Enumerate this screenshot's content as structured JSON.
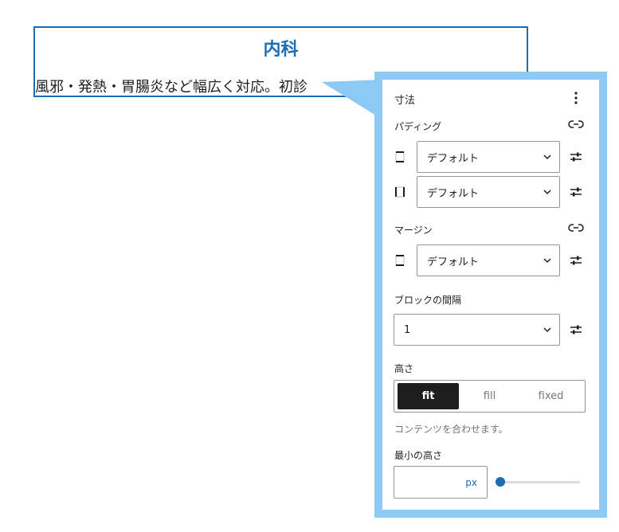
{
  "block": {
    "title": "内科",
    "text": "風邪・発熱・胃腸炎など幅広く対応。初診"
  },
  "panel": {
    "title": "寸法",
    "more_icon": "more-vertical-icon",
    "padding": {
      "label": "パディング",
      "link_icon": "unlink-icon",
      "rows": [
        {
          "side_icon": "padding-vertical-icon",
          "value": "デフォルト",
          "settings_icon": "sliders-icon"
        },
        {
          "side_icon": "padding-horizontal-icon",
          "value": "デフォルト",
          "settings_icon": "sliders-icon"
        }
      ]
    },
    "margin": {
      "label": "マージン",
      "link_icon": "unlink-icon",
      "rows": [
        {
          "side_icon": "margin-vertical-icon",
          "value": "デフォルト",
          "settings_icon": "sliders-icon"
        }
      ]
    },
    "block_spacing": {
      "label": "ブロックの間隔",
      "value": "1",
      "settings_icon": "sliders-icon"
    },
    "height": {
      "label": "高さ",
      "options": [
        "fit",
        "fill",
        "fixed"
      ],
      "selected": "fit",
      "help": "コンテンツを合わせます。"
    },
    "min_height": {
      "label": "最小の高さ",
      "value": "",
      "unit": "px",
      "slider_value": 0
    }
  },
  "colors": {
    "accent": "#1c6db5",
    "frame": "#8dc9f5",
    "active_segment": "#1e1e1e"
  }
}
